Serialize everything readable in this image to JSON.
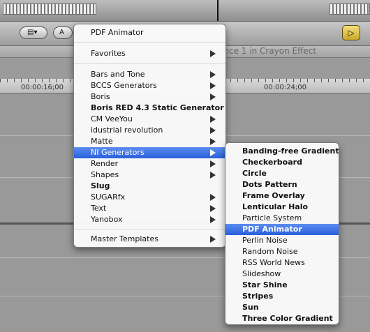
{
  "background": {
    "sequence_title": "ence 1 in Crayon Effect",
    "timecodes": [
      "00:00:16;00",
      "00:00:24;00"
    ],
    "toolbar_icons": [
      "clip-menu-icon",
      "text-icon",
      "play-icon"
    ]
  },
  "menu": {
    "header": "PDF Animator",
    "favorites": "Favorites",
    "items": [
      {
        "label": "Bars and Tone",
        "submenu": true
      },
      {
        "label": "BCCS Generators",
        "submenu": true
      },
      {
        "label": "Boris",
        "submenu": true
      },
      {
        "label": "Boris RED 4.3 Static Generator",
        "submenu": false
      },
      {
        "label": "CM VeeYou",
        "submenu": true
      },
      {
        "label": "idustrial revolution",
        "submenu": true
      },
      {
        "label": "Matte",
        "submenu": true
      },
      {
        "label": "NI Generators",
        "submenu": true
      },
      {
        "label": "Render",
        "submenu": true
      },
      {
        "label": "Shapes",
        "submenu": true
      },
      {
        "label": "Slug",
        "submenu": false
      },
      {
        "label": "SUGARfx",
        "submenu": true
      },
      {
        "label": "Text",
        "submenu": true
      },
      {
        "label": "Yanobox",
        "submenu": true
      }
    ],
    "master_templates": "Master Templates",
    "selected": "NI Generators"
  },
  "submenu": {
    "items": [
      "Banding-free Gradient",
      "Checkerboard",
      "Circle",
      "Dots Pattern",
      "Frame Overlay",
      "Lenticular Halo",
      "Particle System",
      "PDF Animator",
      "Perlin Noise",
      "Random Noise",
      "RSS World News",
      "Slideshow",
      "Star Shine",
      "Stripes",
      "Sun",
      "Three Color Gradient"
    ],
    "selected": "PDF Animator"
  },
  "colors": {
    "selection": "#2f64dc",
    "menu_bg": "#fafafa"
  }
}
